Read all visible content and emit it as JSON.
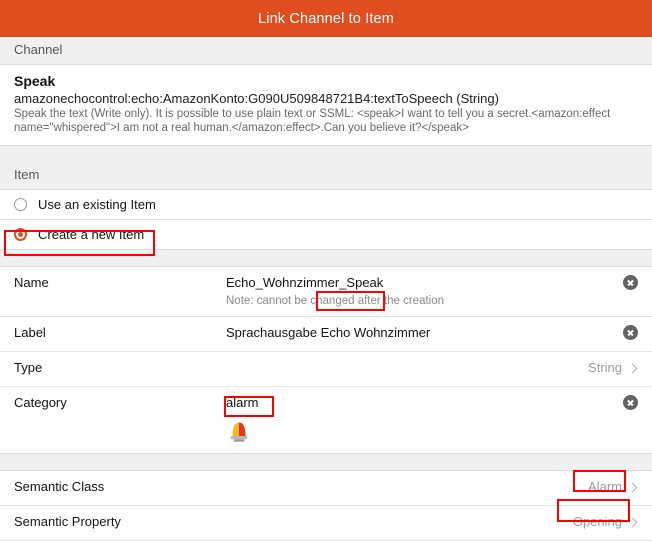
{
  "window": {
    "title": "Link Channel to Item",
    "accent_color": "#e04e20",
    "annotation_color": "#ff0000"
  },
  "channel": {
    "section_label": "Channel",
    "name": "Speak",
    "uid": "amazonechocontrol:echo:AmazonKonto:G090U509848721B4:textToSpeech (String)",
    "description": "Speak the text (Write only). It is possible to use plain text or SSML: <speak>I want to tell you a secret.<amazon:effect name=\"whispered\">I am not a real human.</amazon:effect>.Can you believe it?</speak>"
  },
  "item": {
    "section_label": "Item",
    "options": [
      {
        "label": "Use an existing Item",
        "selected": false
      },
      {
        "label": "Create a new Item",
        "selected": true
      }
    ]
  },
  "form": {
    "name": {
      "label": "Name",
      "value": "Echo_Wohnzimmer_Speak",
      "value_plain": "Echo_Wohnzimmer",
      "value_highlight": "_Speak",
      "note": "Note: cannot be changed after the creation",
      "clear_icon": "clear-circle-icon"
    },
    "item_label": {
      "label": "Label",
      "value": "Sprachausgabe Echo Wohnzimmer",
      "clear_icon": "clear-circle-icon"
    },
    "type": {
      "label": "Type",
      "value": "String",
      "chevron_icon": "chevron-right-icon"
    },
    "category": {
      "label": "Category",
      "value": "alarm",
      "icon_name": "alarm-siren-icon",
      "clear_icon": "clear-circle-icon"
    }
  },
  "semantics": {
    "semantic_class": {
      "label": "Semantic Class",
      "value": "Alarm",
      "chevron_icon": "chevron-right-icon"
    },
    "semantic_property": {
      "label": "Semantic Property",
      "value": "Opening",
      "chevron_icon": "chevron-right-icon"
    }
  }
}
